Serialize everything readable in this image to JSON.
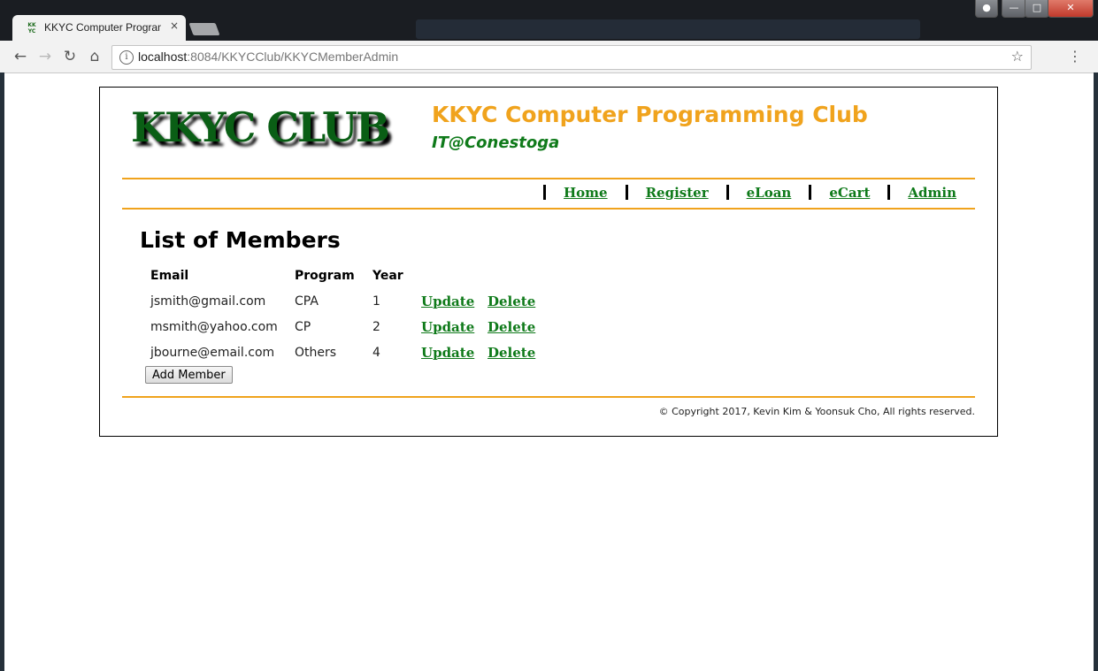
{
  "browser": {
    "tab_title": "KKYC Computer Program",
    "favicon_text": "KK YC",
    "tab_close": "×",
    "url_host": "localhost",
    "url_rest": ":8084/KKYCClub/KKYCMemberAdmin"
  },
  "header": {
    "logo": "KKYC CLUB",
    "title": "KKYC Computer Programming Club",
    "subtitle": "IT@Conestoga"
  },
  "nav": {
    "items": [
      {
        "label": "Home"
      },
      {
        "label": "Register"
      },
      {
        "label": "eLoan"
      },
      {
        "label": "eCart"
      },
      {
        "label": "Admin"
      }
    ]
  },
  "main": {
    "heading": "List of Members",
    "columns": [
      "Email",
      "Program",
      "Year"
    ],
    "rows": [
      {
        "email": "jsmith@gmail.com",
        "program": "CPA",
        "year": "1",
        "update": "Update",
        "delete": "Delete"
      },
      {
        "email": "msmith@yahoo.com",
        "program": "CP",
        "year": "2",
        "update": "Update",
        "delete": "Delete"
      },
      {
        "email": "jbourne@email.com",
        "program": "Others",
        "year": "4",
        "update": "Update",
        "delete": "Delete"
      }
    ],
    "add_button": "Add Member"
  },
  "footer": {
    "copyright": "© Copyright 2017, Kevin Kim & Yoonsuk Cho, All rights reserved."
  },
  "colors": {
    "accent_orange": "#f0a31d",
    "brand_green": "#0f7a1a",
    "logo_green": "#0a5e15"
  },
  "icons": {
    "back": "back-arrow-icon",
    "forward": "forward-arrow-icon",
    "reload": "reload-icon",
    "home": "home-icon",
    "info": "info-icon",
    "bookmark": "star-icon",
    "menu": "kebab-menu-icon"
  }
}
